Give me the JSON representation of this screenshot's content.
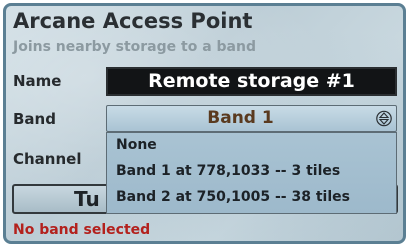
{
  "window": {
    "title": "Arcane Access Point",
    "subtitle": "Joins nearby storage to a band"
  },
  "fields": {
    "name_label": "Name",
    "name_value": "Remote storage #1",
    "band_label": "Band",
    "band_value": "Band 1",
    "channel_label": "Channel"
  },
  "band_dropdown": {
    "options": [
      "None",
      "Band 1 at 778,1033 -- 3 tiles",
      "Band 2 at 750,1005 -- 38 tiles"
    ]
  },
  "tune_button": {
    "label": "Tu"
  },
  "status": {
    "text": "No band selected",
    "color": "#b3211d"
  },
  "icons": {
    "band_select": "updown-arrows-icon"
  },
  "colors": {
    "accent_border": "#5b7f93",
    "band_text": "#5a3a1f"
  }
}
